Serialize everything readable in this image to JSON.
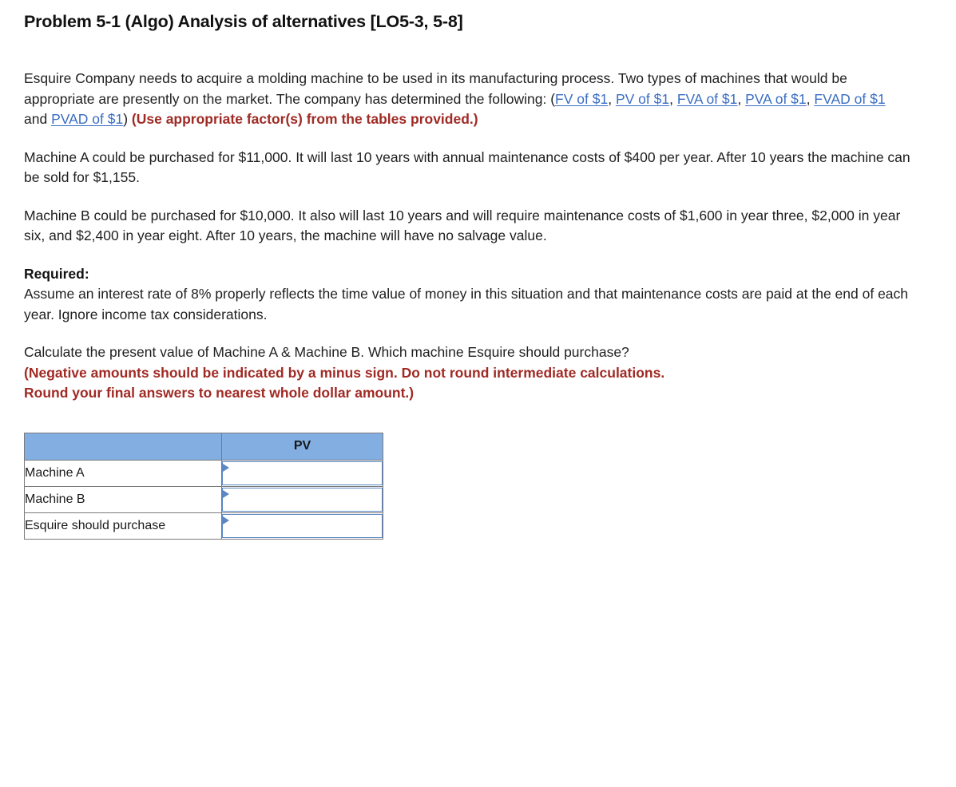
{
  "title": "Problem 5-1 (Algo) Analysis of alternatives [LO5-3, 5-8]",
  "intro": {
    "part1": "Esquire Company needs to acquire a molding machine to be used in its manufacturing process. Two types of machines that would be appropriate are presently on the market. The company has determined the following: (",
    "links": [
      {
        "label": "FV of $1"
      },
      {
        "label": "PV of $1"
      },
      {
        "label": "FVA of $1"
      },
      {
        "label": "PVA of $1"
      },
      {
        "label": "FVAD of $1"
      },
      {
        "label": "PVAD of $1"
      }
    ],
    "sep_comma": ", ",
    "sep_and": " and ",
    "close_paren": ") ",
    "emphasis": "(Use appropriate factor(s) from the tables provided.)"
  },
  "machine_a": "Machine A could be purchased for $11,000. It will last 10 years with annual maintenance costs of $400 per year. After 10 years the machine can be sold for $1,155.",
  "machine_b": "Machine B could be purchased for $10,000. It also will last 10 years and will require maintenance costs of $1,600 in year three, $2,000 in year six, and $2,400 in year eight. After 10 years, the machine will have no salvage value.",
  "required": {
    "heading": "Required:",
    "body": "Assume an interest rate of 8% properly reflects the time value of money in this situation and that maintenance costs are paid at the end of each year. Ignore income tax considerations."
  },
  "question": {
    "prompt": "Calculate the present value of Machine A & Machine B. Which machine Esquire should purchase?",
    "emphasis_line1": "(Negative amounts should be indicated by a minus sign. Do not round intermediate calculations.",
    "emphasis_line2": "Round your final answers to nearest whole dollar amount.)"
  },
  "answer_table": {
    "headers": [
      "",
      "PV"
    ],
    "rows": [
      {
        "label": "Machine A",
        "value": ""
      },
      {
        "label": "Machine B",
        "value": ""
      },
      {
        "label": "Esquire should purchase",
        "value": ""
      }
    ]
  },
  "colors": {
    "link": "#3a6dc4",
    "emphasis_red": "#a02a24",
    "table_header_blue": "#82aee2",
    "input_border_blue": "#5b87c4",
    "table_border_gray": "#7a7a7a"
  }
}
